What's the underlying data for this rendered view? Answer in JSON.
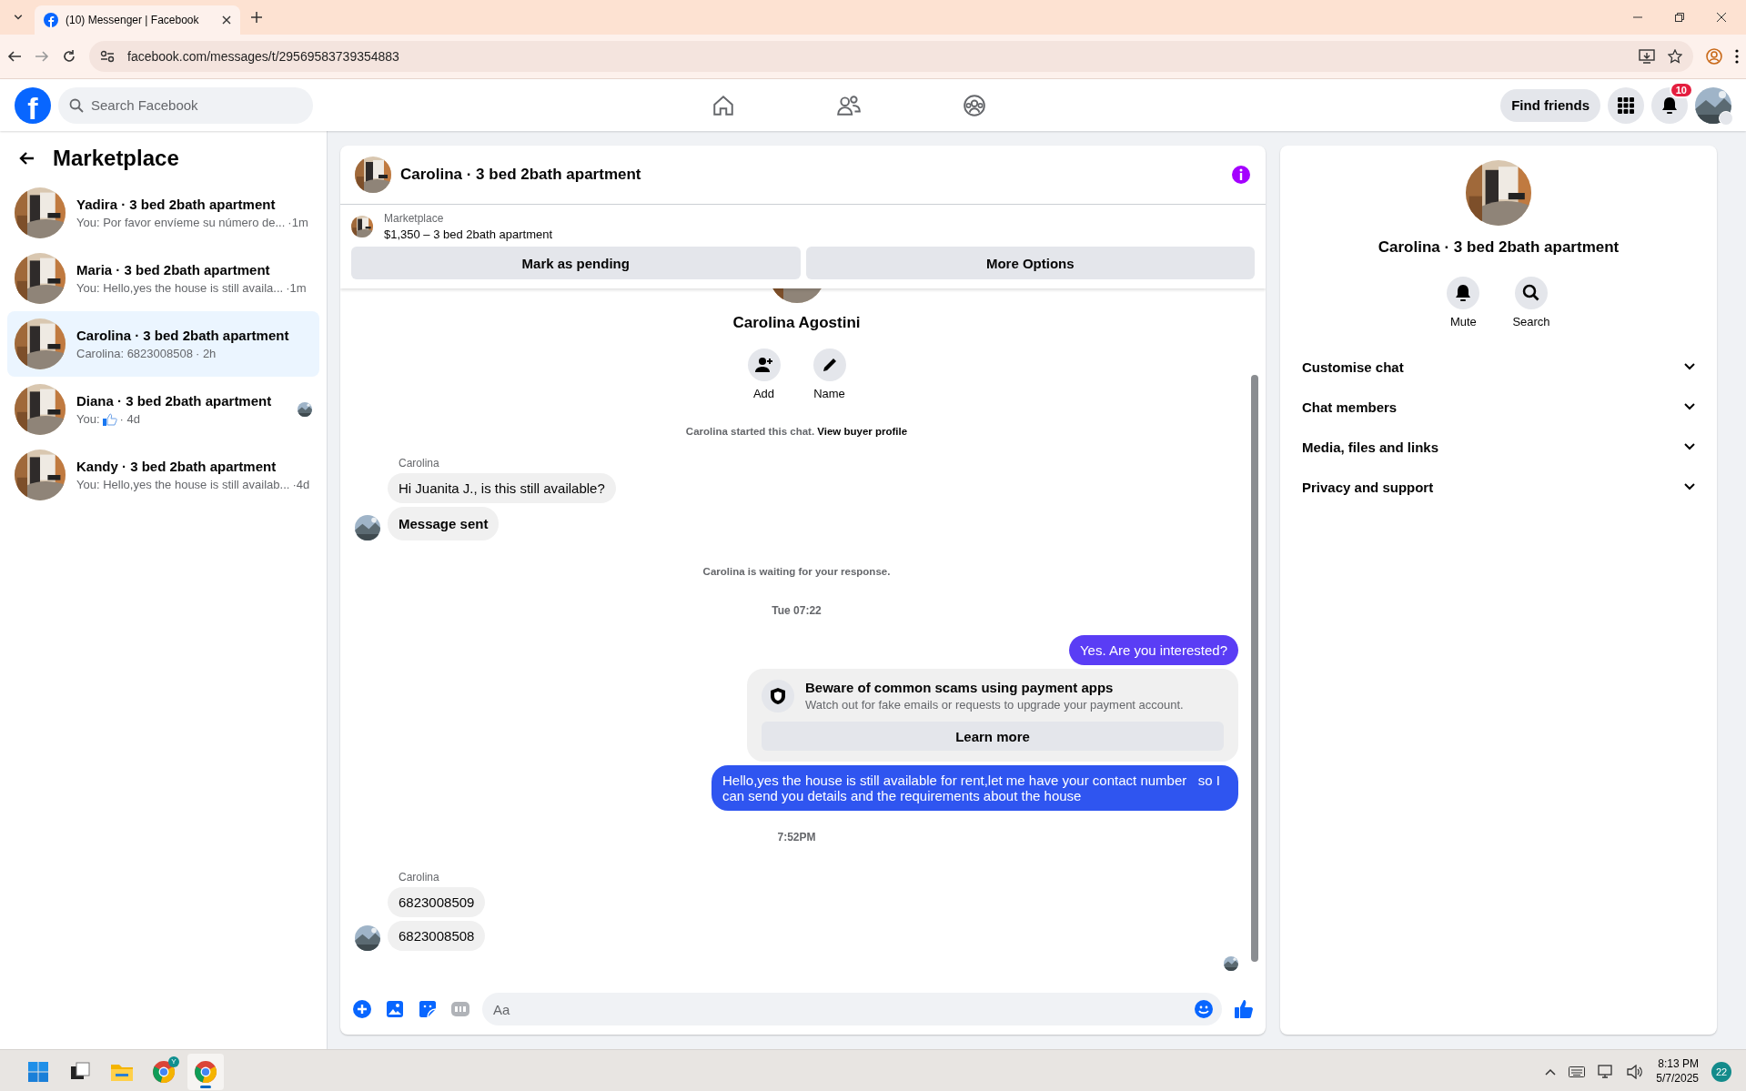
{
  "browser": {
    "tab_title": "(10) Messenger | Facebook",
    "url": "facebook.com/messages/t/29569583739354883"
  },
  "header": {
    "logo": "f",
    "search_placeholder": "Search Facebook",
    "find_friends": "Find friends",
    "notification_count": "10"
  },
  "sidebar": {
    "title": "Marketplace",
    "conversations": [
      {
        "title": "Yadira · 3 bed 2bath apartment",
        "kind": "text",
        "preview": "You: Por favor envíeme su número de...",
        "time": "·1m",
        "selected": false,
        "seen": false
      },
      {
        "title": "Maria · 3 bed 2bath apartment",
        "kind": "text",
        "preview": "You: Hello,yes the house is still availa...",
        "time": "·1m",
        "selected": false,
        "seen": false
      },
      {
        "title": "Carolina · 3 bed 2bath apartment",
        "kind": "text",
        "preview": "Carolina: 6823008508",
        "time": "· 2h",
        "selected": true,
        "seen": false
      },
      {
        "title": "Diana · 3 bed 2bath apartment",
        "kind": "like",
        "preview": "You:",
        "time": "· 4d",
        "selected": false,
        "seen": true
      },
      {
        "title": "Kandy · 3 bed 2bath apartment",
        "kind": "text",
        "preview": "You: Hello,yes the house is still availab...",
        "time": "·4d",
        "selected": false,
        "seen": false
      }
    ]
  },
  "chat": {
    "title": "Carolina · 3 bed 2bath apartment",
    "listing_label": "Marketplace",
    "listing": "$1,350 – 3 bed 2bath apartment",
    "buttons": [
      "Mark as pending",
      "More Options"
    ],
    "profile_name": "Carolina Agostini",
    "profile_actions": [
      {
        "kind": "add",
        "label": "Add"
      },
      {
        "kind": "name",
        "label": "Name"
      }
    ],
    "messages": [
      {
        "kind": "system",
        "text": "Carolina started this chat.",
        "link": "View buyer profile"
      },
      {
        "kind": "incoming",
        "sender": "Carolina",
        "bubbles": [
          {
            "text": "Hi Juanita J., is this still available?",
            "bold": false
          },
          {
            "text": "Message sent",
            "bold": true
          }
        ]
      },
      {
        "kind": "system",
        "text": "Carolina is waiting for your response."
      },
      {
        "kind": "time",
        "text": "Tue 07:22"
      },
      {
        "kind": "outgoing",
        "text": "Yes. Are you interested?",
        "color": "#5a3df5"
      },
      {
        "kind": "warning",
        "title": "Beware of common scams using payment apps",
        "body": "Watch out for fake emails or requests to upgrade your payment account.",
        "button": "Learn more"
      },
      {
        "kind": "outgoing",
        "text": "Hello,yes the house is still available for rent,let me have your contact number   so I can send you details and the requirements about the house",
        "color": "#2f55f0"
      },
      {
        "kind": "time",
        "text": "7:52PM"
      },
      {
        "kind": "incoming",
        "sender": "Carolina",
        "bubbles": [
          {
            "text": "6823008509",
            "bold": false
          },
          {
            "text": "6823008508",
            "bold": false
          }
        ]
      },
      {
        "kind": "seen"
      }
    ],
    "composer_placeholder": "Aa"
  },
  "info_panel": {
    "title": "Carolina · 3 bed 2bath apartment",
    "actions": [
      {
        "kind": "mute",
        "label": "Mute"
      },
      {
        "kind": "search",
        "label": "Search"
      }
    ],
    "sections": [
      {
        "label": "Customise chat",
        "expanded": false
      },
      {
        "label": "Chat members",
        "expanded": false
      },
      {
        "label": "Media, files and links",
        "expanded": false
      },
      {
        "label": "Privacy and support",
        "expanded": false
      }
    ]
  },
  "taskbar": {
    "apps": [
      {
        "kind": "start",
        "selected": false
      },
      {
        "kind": "taskview",
        "selected": false
      },
      {
        "kind": "folder",
        "selected": false
      },
      {
        "kind": "chrome",
        "badge": "Y",
        "selected": false
      },
      {
        "kind": "chrome",
        "selected": true
      }
    ],
    "time": "8:13 PM",
    "date": "5/7/2025",
    "notifications": "22"
  }
}
